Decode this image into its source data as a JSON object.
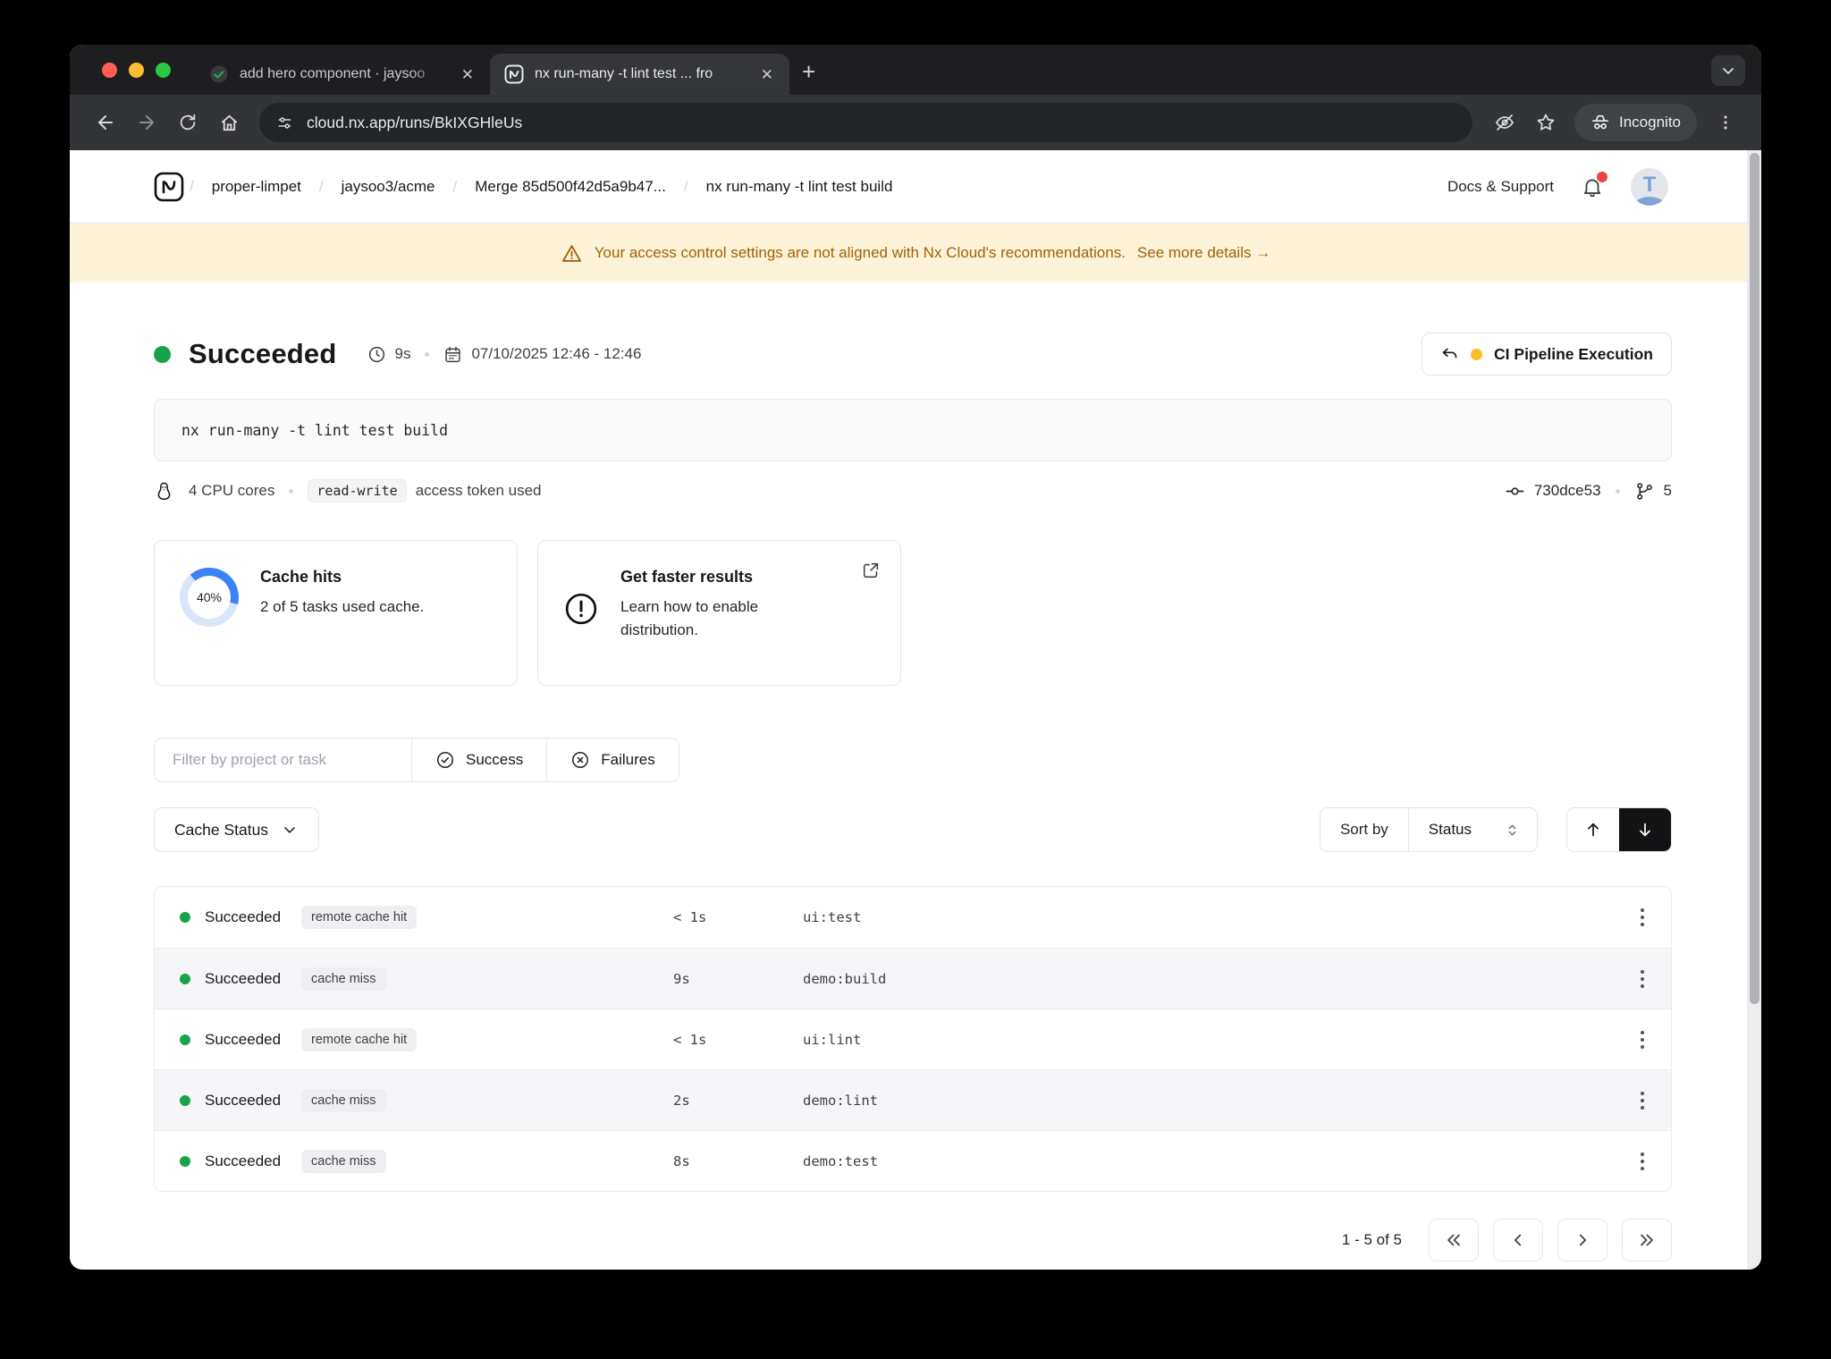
{
  "browser": {
    "tabs": [
      {
        "title": "add hero component · jaysoo",
        "favicon": "pr-check-icon"
      },
      {
        "title": "nx run-many -t lint test ... fro",
        "favicon": "nx-icon"
      }
    ],
    "new_tab": "+",
    "url": "cloud.nx.app/runs/BkIXGHleUs",
    "incognito_label": "Incognito"
  },
  "header": {
    "breadcrumbs": [
      "proper-limpet",
      "jaysoo3/acme",
      "Merge 85d500f42d5a9b47...",
      "nx run-many -t lint test build"
    ],
    "docs_support": "Docs & Support",
    "avatar_letter": "T"
  },
  "banner": {
    "text": "Your access control settings are not aligned with Nx Cloud's recommendations.",
    "link": "See more details →"
  },
  "run": {
    "status": "Succeeded",
    "duration": "9s",
    "date_range": "07/10/2025 12:46 - 12:46",
    "pipeline_button": "CI Pipeline Execution",
    "command": "nx run-many -t lint test build",
    "cpu": "4 CPU cores",
    "token_badge": "read-write",
    "token_suffix": "access token used",
    "commit": "730dce53",
    "branch_count": "5"
  },
  "cards": {
    "cache": {
      "percent": "40%",
      "percent_value": 40,
      "title": "Cache hits",
      "subtitle": "2 of 5 tasks used cache."
    },
    "faster": {
      "title": "Get faster results",
      "subtitle": "Learn how to enable distribution."
    }
  },
  "filters": {
    "placeholder": "Filter by project or task",
    "success": "Success",
    "failures": "Failures",
    "cache_status": "Cache Status",
    "sort_by": "Sort by",
    "sort_value": "Status"
  },
  "table": {
    "rows": [
      {
        "status": "Succeeded",
        "badge": "remote cache hit",
        "duration": "< 1s",
        "task": "ui:test"
      },
      {
        "status": "Succeeded",
        "badge": "cache miss",
        "duration": "9s",
        "task": "demo:build"
      },
      {
        "status": "Succeeded",
        "badge": "remote cache hit",
        "duration": "< 1s",
        "task": "ui:lint"
      },
      {
        "status": "Succeeded",
        "badge": "cache miss",
        "duration": "2s",
        "task": "demo:lint"
      },
      {
        "status": "Succeeded",
        "badge": "cache miss",
        "duration": "8s",
        "task": "demo:test"
      }
    ]
  },
  "pagination": {
    "label": "1 - 5 of 5"
  },
  "colors": {
    "success_green": "#16a34a",
    "banner_bg": "#fcf3d8",
    "banner_text": "#a16207",
    "donut_blue": "#3b82f6",
    "donut_track": "#d9e6f9",
    "accent_amber": "#fbbf24",
    "notification_red": "#ef4444",
    "active_sort_bg": "#131316"
  }
}
